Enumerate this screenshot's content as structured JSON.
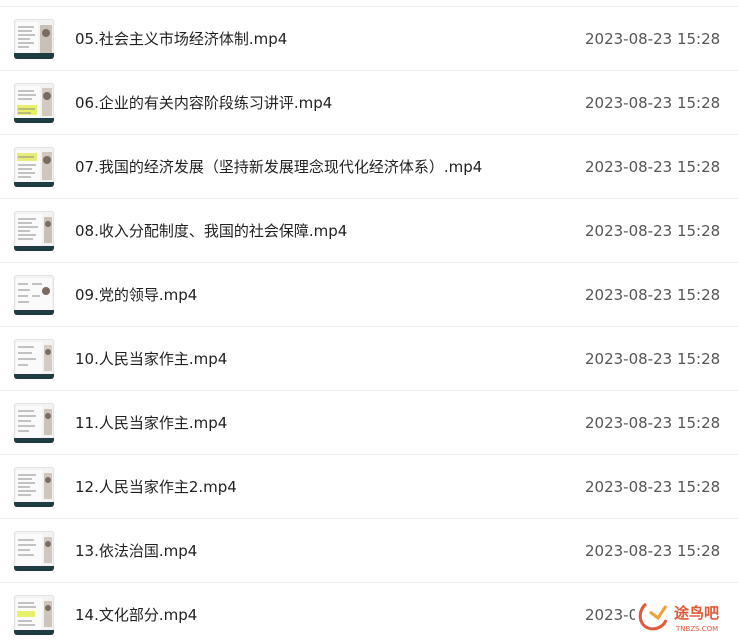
{
  "files": [
    {
      "name": "05.社会主义市场经济体制.mp4",
      "date": "2023-08-23 15:28",
      "icon": "video-thumbnail-icon"
    },
    {
      "name": "06.企业的有关内容阶段练习讲评.mp4",
      "date": "2023-08-23 15:28",
      "icon": "video-thumbnail-icon"
    },
    {
      "name": "07.我国的经济发展（坚持新发展理念现代化经济体系）.mp4",
      "date": "2023-08-23 15:28",
      "icon": "video-thumbnail-icon"
    },
    {
      "name": "08.收入分配制度、我国的社会保障.mp4",
      "date": "2023-08-23 15:28",
      "icon": "video-thumbnail-icon"
    },
    {
      "name": "09.党的领导.mp4",
      "date": "2023-08-23 15:28",
      "icon": "video-thumbnail-icon"
    },
    {
      "name": "10.人民当家作主.mp4",
      "date": "2023-08-23 15:28",
      "icon": "video-thumbnail-icon"
    },
    {
      "name": "11.人民当家作主.mp4",
      "date": "2023-08-23 15:28",
      "icon": "video-thumbnail-icon"
    },
    {
      "name": "12.人民当家作主2.mp4",
      "date": "2023-08-23 15:28",
      "icon": "video-thumbnail-icon"
    },
    {
      "name": "13.依法治国.mp4",
      "date": "2023-08-23 15:28",
      "icon": "video-thumbnail-icon"
    },
    {
      "name": "14.文化部分.mp4",
      "date": "2023-08-23 15:28",
      "icon": "video-thumbnail-icon"
    }
  ],
  "watermark": {
    "text": "途鸟吧",
    "subtext": "TNBZS.COM",
    "color": "#e05a3a"
  }
}
